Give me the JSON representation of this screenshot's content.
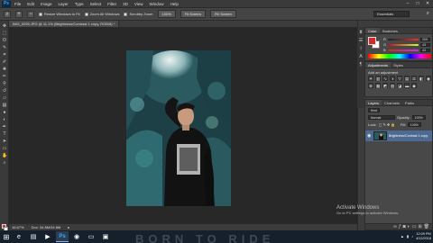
{
  "app": {
    "logo": "Ps"
  },
  "menu": [
    "File",
    "Edit",
    "Image",
    "Layer",
    "Type",
    "Select",
    "Filter",
    "3D",
    "View",
    "Window",
    "Help"
  ],
  "options": {
    "resize_windows": "Resize Windows to Fit",
    "zoom_all_windows": "Zoom All Windows",
    "scrubby_zoom": "Scrubby Zoom",
    "zoom_100": "100%",
    "fit_screen": "Fit Screen",
    "fill_screen": "Fill Screen"
  },
  "workspace": "Essentials",
  "document": {
    "tab_title": "IMG_0295.JPG @ 11.1% (Brightness/Contrast 1 copy, RGB/8) *"
  },
  "status": {
    "zoom": "16.67%",
    "doc_size": "Doc: 34.8M/34.8M"
  },
  "panels": {
    "color": {
      "tabs": [
        "Color",
        "Swatches"
      ],
      "fg_color": "#d12b2b",
      "r": "209",
      "g": "43",
      "b": "43"
    },
    "adjustments": {
      "tabs": [
        "Adjustments",
        "Styles"
      ],
      "title": "Add an adjustment"
    },
    "layers": {
      "tabs": [
        "Layers",
        "Channels",
        "Paths"
      ],
      "kind": "Kind",
      "blend": "Normal",
      "opacity_label": "Opacity:",
      "opacity": "100%",
      "lock_label": "Lock:",
      "fill_label": "Fill:",
      "fill": "100%",
      "layer_name": "Brightness/Contrast 1 copy"
    }
  },
  "activate": {
    "title": "Activate Windows",
    "subtitle": "Go to PC settings to activate Windows."
  },
  "taskbar": {
    "time": "12:09 PM",
    "date": "4/12/2018",
    "watermark": "BORN TO RIDE"
  },
  "colors": {
    "accent": "#4d6a93",
    "foreground": "#d12b2b"
  }
}
